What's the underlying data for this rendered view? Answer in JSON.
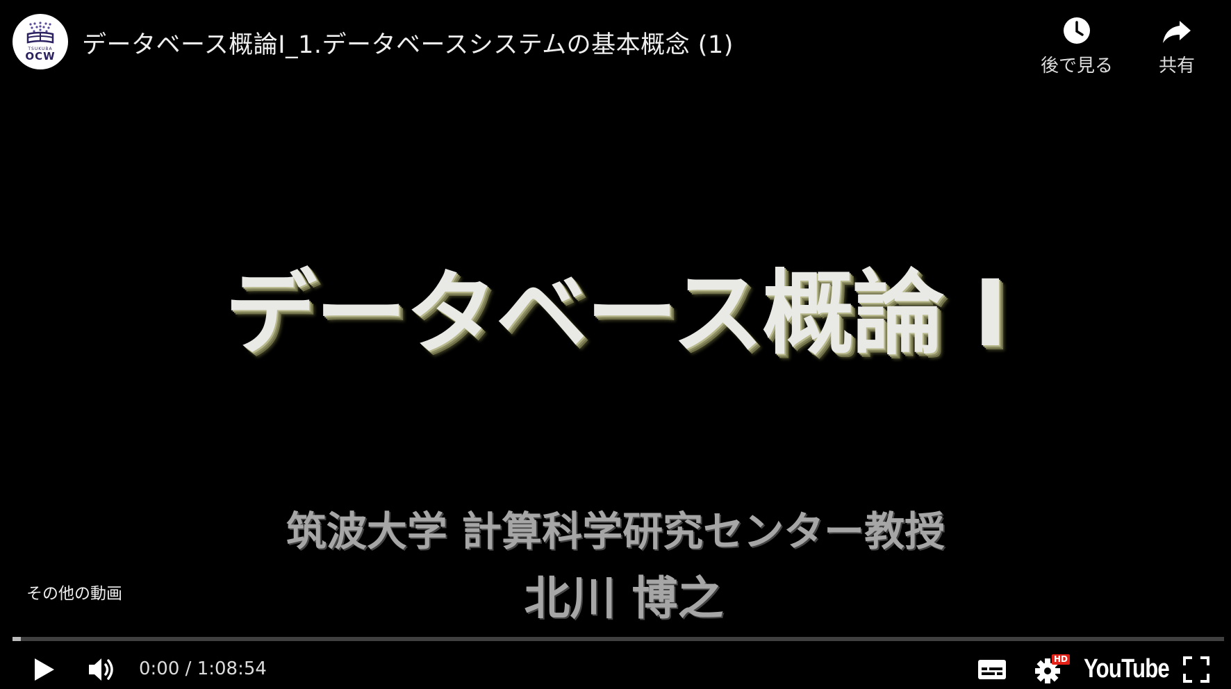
{
  "channel": {
    "logo_subtext": "TSUKUBA",
    "logo_text": "OCW"
  },
  "video": {
    "title": "データベース概論I_1.データベースシステムの基本概念 (1)"
  },
  "top_actions": {
    "watch_later_label": "後で見る",
    "share_label": "共有"
  },
  "slide": {
    "title": "データベース概論 I",
    "affiliation": "筑波大学 計算科学研究センター教授",
    "lecturer": "北川 博之"
  },
  "overlay": {
    "more_videos": "その他の動画"
  },
  "controls": {
    "current_time": "0:00",
    "separator": " / ",
    "duration": "1:08:54",
    "youtube_label": "YouTube",
    "hd_badge": "HD",
    "progress_fraction": 0.0
  },
  "colors": {
    "logo_purple": "#2b2160",
    "progress_red": "#ff0000",
    "hd_red": "#e62117"
  }
}
